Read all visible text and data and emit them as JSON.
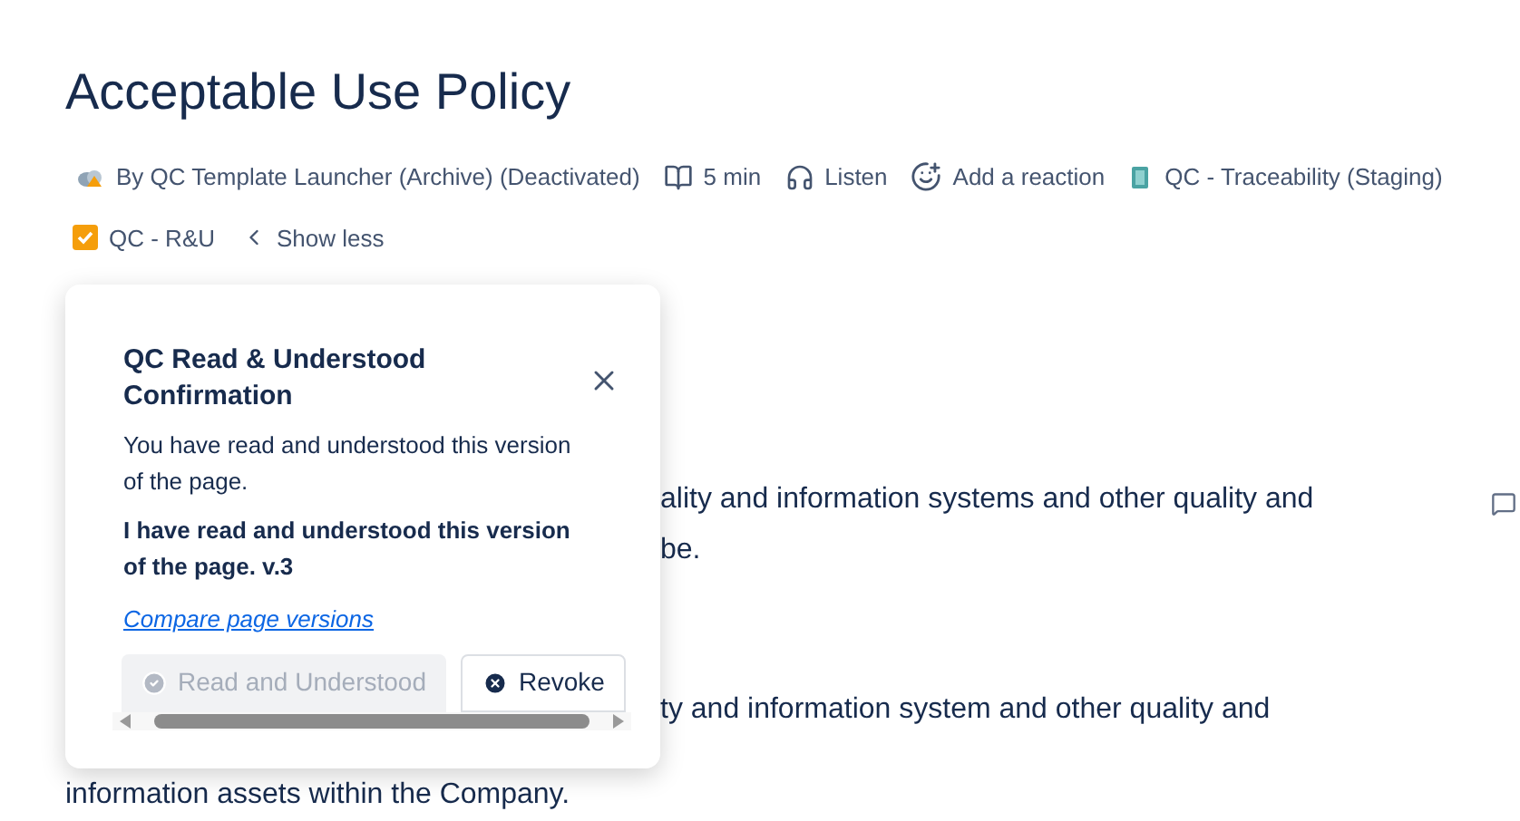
{
  "title": "Acceptable Use Policy",
  "meta": [
    {
      "kind": "author",
      "label": "By QC Template Launcher (Archive) (Deactivated)"
    },
    {
      "kind": "read_time",
      "label": "5 min"
    },
    {
      "kind": "listen",
      "label": "Listen"
    },
    {
      "kind": "reaction",
      "label": "Add a reaction"
    },
    {
      "kind": "space",
      "label": "QC - Traceability (Staging)"
    }
  ],
  "meta_row_2": [
    {
      "kind": "label",
      "label": "QC - R&U"
    },
    {
      "kind": "toggle",
      "label": "Show less"
    }
  ],
  "body_paragraphs": [
    {
      "lines": [
        "ality and information systems and other quality and",
        "be."
      ]
    },
    {
      "lines": [
        "ty and information system and other quality and"
      ]
    }
  ],
  "last_line": "information assets within the Company.",
  "popover": {
    "title": "QC Read & Understood Confirmation",
    "message": "You have read and understood this version of the page.",
    "confirmation": "I have read and understood this version of the page. v.3",
    "link": "Compare page versions",
    "buttons": [
      {
        "kind": "confirm",
        "label": "Read and Understood",
        "disabled": true
      },
      {
        "kind": "revoke",
        "label": "Revoke",
        "disabled": false
      }
    ]
  }
}
